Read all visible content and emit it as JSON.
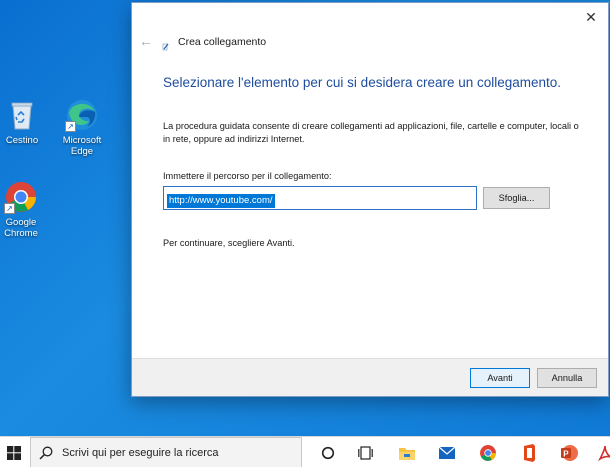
{
  "desktop": {
    "icons": [
      {
        "label": "Cestino",
        "icon": "recycle-bin-icon"
      },
      {
        "label": "Microsoft Edge",
        "icon": "edge-icon"
      },
      {
        "label": "Google Chrome",
        "icon": "chrome-icon"
      }
    ],
    "background_color": "#0f79d6"
  },
  "dialog": {
    "title": "Crea collegamento",
    "heading": "Selezionare l'elemento per cui si desidera creare un collegamento.",
    "description": "La procedura guidata consente di creare collegamenti ad applicazioni, file, cartelle e computer, locali o in rete, oppure ad indirizzi Internet.",
    "path_label": "Immettere il percorso per il collegamento:",
    "path_value": "http://www.youtube.com/",
    "browse_label": "Sfoglia...",
    "continue_text": "Per continuare, scegliere Avanti.",
    "next_label": "Avanti",
    "cancel_label": "Annulla",
    "heading_color": "#1e4d9b",
    "selection_color": "#0078d7"
  },
  "taskbar": {
    "search_placeholder": "Scrivi qui per eseguire la ricerca",
    "icons": [
      "cortana-icon",
      "task-view-icon",
      "file-explorer-icon",
      "mail-icon",
      "chrome-icon",
      "office-icon",
      "powerpoint-icon",
      "acrobat-icon"
    ],
    "accent": "#0078d7"
  }
}
